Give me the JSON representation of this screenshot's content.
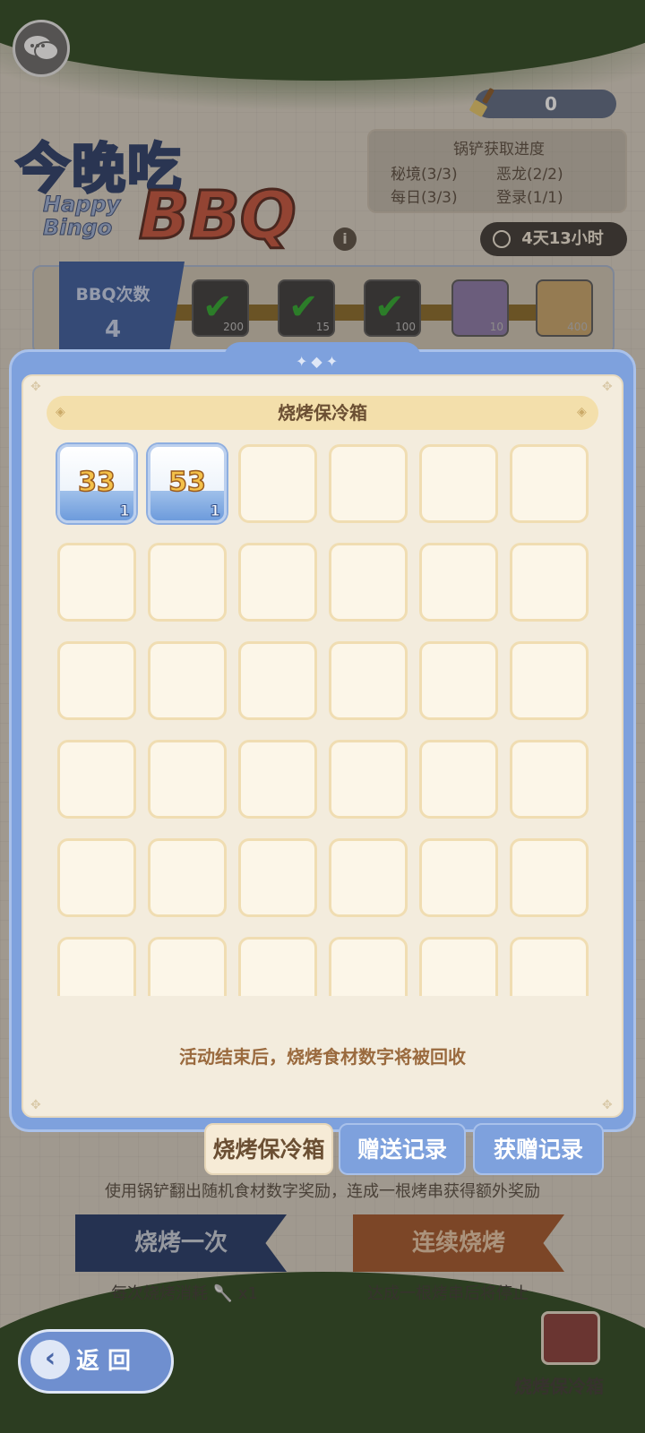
{
  "header": {
    "currency_value": "0",
    "logo_cn": "今晚吃",
    "logo_happy": "Happy",
    "logo_bingo": "Bingo",
    "logo_bbq": "BBQ",
    "info_glyph": "i",
    "progress_panel": {
      "title": "锅铲获取进度",
      "items": [
        "秘境(3/3)",
        "恶龙(2/2)",
        "每日(3/3)",
        "登录(1/1)"
      ]
    },
    "timer": "4天13小时"
  },
  "bbq_strip": {
    "label": "BBQ次数",
    "count": "4",
    "rewards": [
      {
        "qty": "200",
        "claimed": true
      },
      {
        "qty": "15",
        "claimed": true
      },
      {
        "qty": "100",
        "claimed": true
      },
      {
        "qty": "10",
        "claimed": false
      },
      {
        "qty": "400",
        "claimed": false
      }
    ]
  },
  "modal": {
    "title": "烧烤保冷箱",
    "items": [
      {
        "number": "33",
        "count": "1"
      },
      {
        "number": "53",
        "count": "1"
      }
    ],
    "empty_slots": 34,
    "notice": "活动结束后，烧烤食材数字将被回收"
  },
  "tabs": {
    "cooler": "烧烤保冷箱",
    "gift_record": "赠送记录",
    "receive_record": "获赠记录"
  },
  "footer": {
    "tip": "使用锅铲翻出随机食材数字奖励，连成一根烤串获得额外奖励",
    "grill_once": "烧烤一次",
    "grill_continuous": "连续烧烤",
    "grill_once_sub": "每次烧烤消耗",
    "grill_once_cost": "x1",
    "grill_continuous_sub": "达成一根烤串后将停止",
    "back": "返 回",
    "cooler_label": "烧烤保冷箱"
  },
  "icons": {
    "chat": "chat-bubbles-icon",
    "currency": "spatula-icon",
    "timer": "clock-icon",
    "back": "chevron-left-icon",
    "cooler": "cooler-box-icon",
    "check": "checkmark-icon"
  },
  "colors": {
    "modal_frame": "#7ea1dd",
    "modal_panel": "#f3ecdd",
    "title_bar": "#f3dfab",
    "number_gold": "#f4c14a",
    "notice_brown": "#9a6a3e"
  }
}
